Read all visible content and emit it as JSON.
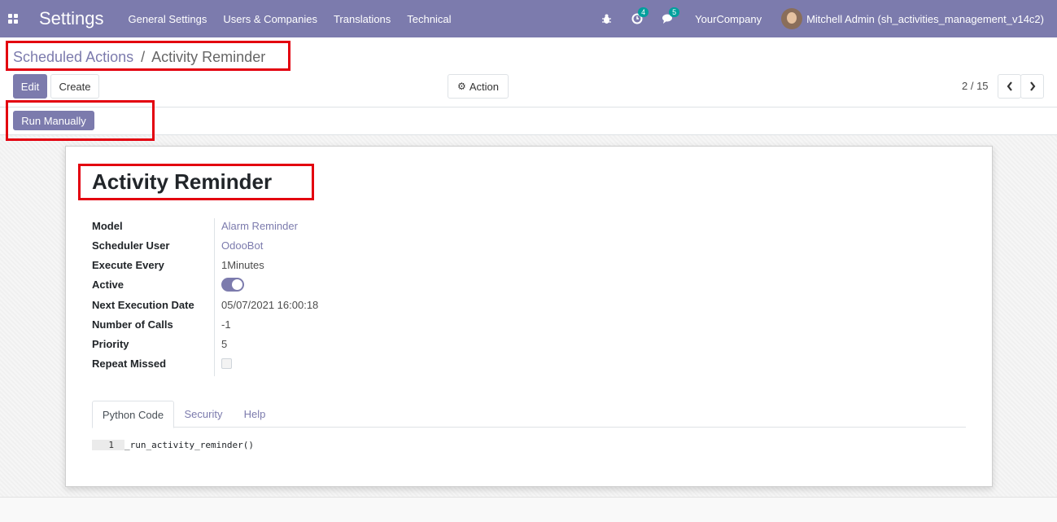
{
  "navbar": {
    "brand": "Settings",
    "menu": [
      "General Settings",
      "Users & Companies",
      "Translations",
      "Technical"
    ],
    "activity_count": "4",
    "message_count": "5",
    "company": "YourCompany",
    "user": "Mitchell Admin (sh_activities_management_v14c2)"
  },
  "breadcrumb": {
    "parent": "Scheduled Actions",
    "separator": "/",
    "current": "Activity Reminder"
  },
  "buttons": {
    "edit": "Edit",
    "create": "Create",
    "action": "Action",
    "run_manually": "Run Manually"
  },
  "pager": {
    "value": "2 / 15"
  },
  "record": {
    "title": "Activity Reminder",
    "fields": [
      {
        "label": "Model",
        "value": "Alarm Reminder"
      },
      {
        "label": "Scheduler User",
        "value": "OdooBot"
      },
      {
        "label": "Execute Every",
        "value": "1Minutes"
      },
      {
        "label": "Active",
        "value": ""
      },
      {
        "label": "Next Execution Date",
        "value": "05/07/2021 16:00:18"
      },
      {
        "label": "Number of Calls",
        "value": "-1"
      },
      {
        "label": "Priority",
        "value": "5"
      },
      {
        "label": "Repeat Missed",
        "value": ""
      }
    ],
    "active": true,
    "repeat_missed": false
  },
  "tabs": [
    "Python Code",
    "Security",
    "Help"
  ],
  "code": {
    "line_number": "1",
    "text": "_run_activity_reminder()"
  },
  "colors": {
    "brand": "#7c7bad",
    "highlight": "#e3000f",
    "badge": "#00a09d"
  }
}
